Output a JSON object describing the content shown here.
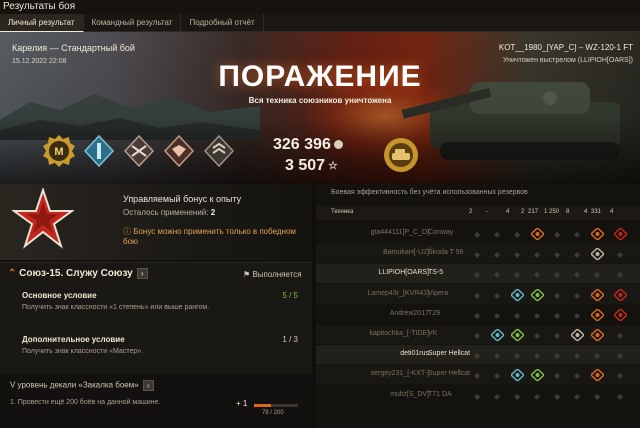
{
  "window_title": "Результаты боя",
  "tabs": [
    {
      "label": "Личный результат"
    },
    {
      "label": "Командный результат"
    },
    {
      "label": "Подробный отчёт"
    }
  ],
  "hero": {
    "map_mode": "Карелия — Стандартный бой",
    "date": "15.12.2022 22:08",
    "player_vehicle": "KOT__1980_[YAP_C] – WZ-120-1 FT",
    "killed_by": "Уничтожен выстрелом (LLIPIOH[OARS])",
    "result": "ПОРАЖЕНИЕ",
    "result_subtitle": "Вся техника союзников уничтожена",
    "credits": "326 396",
    "experience": "3 507",
    "mastery_letter": "M"
  },
  "bonus": {
    "title": "Управляемый бонус к опыту",
    "remaining_label": "Осталось применений:",
    "remaining_value": "2",
    "warning": "Бонус можно применить только в победном бою"
  },
  "mission": {
    "title": "Союз-15. Служу Союзу",
    "status": "Выполняется",
    "primary_label": "Основное условие",
    "primary_text": "Получить знак классности «1 степень» или выше рангом.",
    "primary_progress": "5 / 5",
    "secondary_label": "Дополнительное условие",
    "secondary_text": "Получить знак классности «Мастер».",
    "secondary_progress": "1 / 3"
  },
  "decal": {
    "title": "V уровень декали «Закалка боем»",
    "task": "1. Провести ещё 200 боёв на данной машине.",
    "plus": "+ 1",
    "progress_text": "78 / 200",
    "progress_fraction": 0.39
  },
  "efficiency": {
    "title": "Боевая эффективность без учёта использованных резервов",
    "header_vehicle": "Техника",
    "header_values": [
      "2",
      "-",
      "4",
      "2",
      "217",
      "1 250",
      "8",
      "4",
      "331",
      "4"
    ],
    "rows": [
      {
        "player": "gta444111[P_C_D]",
        "tank": "Conway",
        "alive": false
      },
      {
        "player": "BamukaH[-U2]",
        "tank": "Škoda T 56",
        "alive": false
      },
      {
        "player": "LLIPIOH[OARS]",
        "tank": "TS-5",
        "alive": true
      },
      {
        "player": "Lamep43r_[KVR43]",
        "tank": "Vipera",
        "alive": false
      },
      {
        "player": "Andrew2017",
        "tank": "T29",
        "alive": false
      },
      {
        "player": "kapitochka_[-TIDE]",
        "tank": "VK",
        "alive": false
      },
      {
        "player": "deti01rus",
        "tank": "Super Hellcat",
        "alive": true
      },
      {
        "player": "sergey231_[-KXT-]",
        "tank": "Super Hellcat",
        "alive": false
      },
      {
        "player": "multz[S_DV]",
        "tank": "T71 DA",
        "alive": false
      }
    ]
  },
  "colors": {
    "accent_orange": "#e4751e",
    "header_bg": "#1a1713",
    "defeat_red": "#c3261c"
  }
}
